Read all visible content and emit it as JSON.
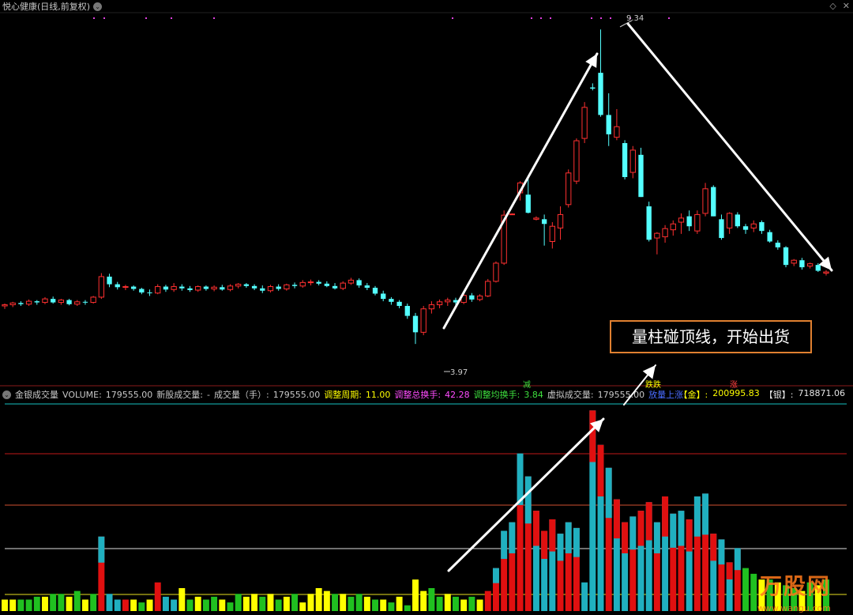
{
  "header": {
    "title": "悦心健康(日线,前复权)",
    "chev": "⌄",
    "icons": [
      "diamond-icon",
      "close-icon"
    ],
    "diamond_glyph": "◇",
    "close_glyph": "✕"
  },
  "price_labels": {
    "high": "9.34",
    "low": "3.97"
  },
  "callout": "量柱碰顶线，开始出货",
  "signals": {
    "jian": "减",
    "xi": "跌跌",
    "zhang": "涨"
  },
  "indicator": {
    "name": "金银成交量",
    "volume_label": "VOLUME:",
    "volume_value": "179555.00",
    "new_vol_label": "新股成交量:",
    "new_vol_value": "-",
    "vol_hand_label": "成交量（手）:",
    "vol_hand_value": "179555.00",
    "period_label": "调整周期:",
    "period_value": "11.00",
    "turnover_total_label": "调整总换手:",
    "turnover_total_value": "42.28",
    "turnover_avg_label": "调整均换手:",
    "turnover_avg_value": "3.84",
    "virtual_label": "虚拟成交量:",
    "virtual_value": "179555.00",
    "rise_label": "放量上涨:",
    "gold_label": "【金】:",
    "gold_value": "200995.83",
    "silver_label": "【银】:",
    "silver_value": "718871.06"
  },
  "watermark": {
    "brand": "万股网",
    "url": "www.wangu.com"
  },
  "colors": {
    "up": "#ff3030",
    "down": "#54ffff",
    "vol_up": "#e01010",
    "vol_down": "#20b0c0",
    "vol_low_up": "#ffff00",
    "vol_low_down": "#20c020"
  },
  "chart_data": {
    "type": "candlestick",
    "candles": [
      [
        4.62,
        4.66,
        4.57,
        4.64
      ],
      [
        4.64,
        4.69,
        4.6,
        4.67
      ],
      [
        4.67,
        4.7,
        4.62,
        4.65
      ],
      [
        4.65,
        4.73,
        4.62,
        4.7
      ],
      [
        4.7,
        4.72,
        4.64,
        4.68
      ],
      [
        4.68,
        4.77,
        4.65,
        4.74
      ],
      [
        4.74,
        4.78,
        4.66,
        4.68
      ],
      [
        4.68,
        4.74,
        4.64,
        4.72
      ],
      [
        4.72,
        4.74,
        4.63,
        4.65
      ],
      [
        4.65,
        4.72,
        4.62,
        4.69
      ],
      [
        4.69,
        4.72,
        4.64,
        4.68
      ],
      [
        4.68,
        4.79,
        4.66,
        4.77
      ],
      [
        4.77,
        5.18,
        4.74,
        5.12
      ],
      [
        5.12,
        5.17,
        4.94,
        4.99
      ],
      [
        4.99,
        5.03,
        4.9,
        4.94
      ],
      [
        4.94,
        4.98,
        4.89,
        4.95
      ],
      [
        4.95,
        4.97,
        4.88,
        4.91
      ],
      [
        4.91,
        4.93,
        4.82,
        4.85
      ],
      [
        4.85,
        4.9,
        4.79,
        4.84
      ],
      [
        4.84,
        4.99,
        4.82,
        4.95
      ],
      [
        4.95,
        4.98,
        4.86,
        4.9
      ],
      [
        4.9,
        5.01,
        4.86,
        4.95
      ],
      [
        4.95,
        4.99,
        4.88,
        4.92
      ],
      [
        4.92,
        4.96,
        4.86,
        4.89
      ],
      [
        4.89,
        4.97,
        4.86,
        4.95
      ],
      [
        4.95,
        4.97,
        4.88,
        4.91
      ],
      [
        4.91,
        4.97,
        4.87,
        4.94
      ],
      [
        4.94,
        4.98,
        4.88,
        4.9
      ],
      [
        4.9,
        4.99,
        4.87,
        4.96
      ],
      [
        4.96,
        5.01,
        4.92,
        4.99
      ],
      [
        4.99,
        5.01,
        4.93,
        4.96
      ],
      [
        4.96,
        4.99,
        4.89,
        4.92
      ],
      [
        4.92,
        4.97,
        4.84,
        4.88
      ],
      [
        4.88,
        4.98,
        4.85,
        4.95
      ],
      [
        4.95,
        4.99,
        4.88,
        4.91
      ],
      [
        4.91,
        5.0,
        4.88,
        4.98
      ],
      [
        4.98,
        5.02,
        4.92,
        4.96
      ],
      [
        4.96,
        5.06,
        4.93,
        5.02
      ],
      [
        5.02,
        5.07,
        4.97,
        5.03
      ],
      [
        5.03,
        5.06,
        4.97,
        5.0
      ],
      [
        5.0,
        5.04,
        4.94,
        4.96
      ],
      [
        4.96,
        5.01,
        4.9,
        4.92
      ],
      [
        4.92,
        5.04,
        4.89,
        5.01
      ],
      [
        5.01,
        5.1,
        4.98,
        5.06
      ],
      [
        5.06,
        5.09,
        4.93,
        4.97
      ],
      [
        4.97,
        5.01,
        4.89,
        4.93
      ],
      [
        4.93,
        4.96,
        4.8,
        4.83
      ],
      [
        4.83,
        4.88,
        4.7,
        4.74
      ],
      [
        4.74,
        4.77,
        4.64,
        4.69
      ],
      [
        4.69,
        4.72,
        4.58,
        4.62
      ],
      [
        4.62,
        4.66,
        4.4,
        4.45
      ],
      [
        4.45,
        4.5,
        3.97,
        4.17
      ],
      [
        4.17,
        4.62,
        4.12,
        4.57
      ],
      [
        4.57,
        4.7,
        4.49,
        4.64
      ],
      [
        4.64,
        4.73,
        4.58,
        4.69
      ],
      [
        4.69,
        4.76,
        4.62,
        4.72
      ],
      [
        4.72,
        4.76,
        4.64,
        4.68
      ],
      [
        4.68,
        4.84,
        4.65,
        4.8
      ],
      [
        4.8,
        4.84,
        4.69,
        4.73
      ],
      [
        4.73,
        4.82,
        4.7,
        4.79
      ],
      [
        4.79,
        5.08,
        4.77,
        5.04
      ],
      [
        5.04,
        5.38,
        5.02,
        5.35
      ],
      [
        5.35,
        6.25,
        5.32,
        6.17
      ],
      [
        6.18,
        6.2,
        6.18,
        6.19
      ],
      [
        6.55,
        6.75,
        6.42,
        6.72
      ],
      [
        6.52,
        6.85,
        6.2,
        6.21
      ],
      [
        6.1,
        6.15,
        6.08,
        6.12
      ],
      [
        6.1,
        6.18,
        5.65,
        6.02
      ],
      [
        5.72,
        6.05,
        5.6,
        5.98
      ],
      [
        5.95,
        6.32,
        5.75,
        6.18
      ],
      [
        6.35,
        6.95,
        6.3,
        6.89
      ],
      [
        6.75,
        7.48,
        6.7,
        7.44
      ],
      [
        7.48,
        8.1,
        7.4,
        8.01
      ],
      [
        8.35,
        8.42,
        8.3,
        8.33
      ],
      [
        8.6,
        9.34,
        7.85,
        7.88
      ],
      [
        7.88,
        8.25,
        7.35,
        7.55
      ],
      [
        7.5,
        7.98,
        7.45,
        7.68
      ],
      [
        7.4,
        7.45,
        6.78,
        6.82
      ],
      [
        6.9,
        7.35,
        6.8,
        7.28
      ],
      [
        7.2,
        7.32,
        6.48,
        6.48
      ],
      [
        6.32,
        6.4,
        5.72,
        5.75
      ],
      [
        5.78,
        5.88,
        5.5,
        5.86
      ],
      [
        5.8,
        6.0,
        5.7,
        5.94
      ],
      [
        5.92,
        6.08,
        5.82,
        6.02
      ],
      [
        6.05,
        6.2,
        5.85,
        6.12
      ],
      [
        6.15,
        6.25,
        5.9,
        5.98
      ],
      [
        5.9,
        6.25,
        5.85,
        6.18
      ],
      [
        6.2,
        6.72,
        6.15,
        6.62
      ],
      [
        6.65,
        6.68,
        6.15,
        6.15
      ],
      [
        6.1,
        6.18,
        5.75,
        5.78
      ],
      [
        5.95,
        6.22,
        5.85,
        6.2
      ],
      [
        6.18,
        6.22,
        5.95,
        5.98
      ],
      [
        5.98,
        6.02,
        5.85,
        5.92
      ],
      [
        5.95,
        6.08,
        5.88,
        6.02
      ],
      [
        6.05,
        6.08,
        5.85,
        5.9
      ],
      [
        5.88,
        5.92,
        5.7,
        5.72
      ],
      [
        5.7,
        5.74,
        5.58,
        5.62
      ],
      [
        5.62,
        5.64,
        5.28,
        5.32
      ],
      [
        5.35,
        5.42,
        5.3,
        5.4
      ],
      [
        5.4,
        5.44,
        5.24,
        5.28
      ],
      [
        5.3,
        5.36,
        5.26,
        5.34
      ],
      [
        5.32,
        5.35,
        5.2,
        5.22
      ],
      [
        5.18,
        5.23,
        5.14,
        5.2
      ]
    ],
    "volumes": [
      4,
      4,
      4,
      4,
      5,
      5,
      6,
      6,
      5,
      7,
      4,
      6,
      26,
      6,
      4,
      4,
      4,
      3,
      4,
      10,
      5,
      4,
      8,
      4,
      5,
      4,
      5,
      4,
      3,
      6,
      5,
      6,
      5,
      6,
      4,
      5,
      6,
      3,
      6,
      8,
      7,
      6,
      6,
      5,
      6,
      5,
      4,
      4,
      3,
      5,
      2,
      11,
      7,
      8,
      5,
      6,
      5,
      4,
      5,
      4,
      7,
      15,
      28,
      31,
      55,
      47,
      35,
      28,
      32,
      27,
      31,
      29,
      10,
      70,
      58,
      50,
      39,
      31,
      33,
      35,
      38,
      31,
      40,
      34,
      35,
      32,
      40,
      41,
      27,
      25,
      17,
      22,
      15,
      13,
      11,
      11,
      10,
      9,
      8,
      7,
      10,
      9,
      11
    ],
    "volume_color": [
      "y",
      "y",
      "g",
      "g",
      "g",
      "y",
      "g",
      "g",
      "y",
      "g",
      "y",
      "g",
      "u",
      "d",
      "d",
      "u",
      "y",
      "g",
      "y",
      "u",
      "d",
      "d",
      "y",
      "g",
      "y",
      "g",
      "g",
      "y",
      "g",
      "g",
      "y",
      "y",
      "g",
      "y",
      "g",
      "y",
      "g",
      "y",
      "y",
      "y",
      "y",
      "g",
      "y",
      "g",
      "g",
      "y",
      "g",
      "y",
      "g",
      "y",
      "g",
      "y",
      "y",
      "g",
      "g",
      "y",
      "g",
      "y",
      "g",
      "y",
      "u",
      "u",
      "u",
      "u",
      "u",
      "u",
      "d",
      "d",
      "d",
      "u",
      "u",
      "u",
      "d",
      "d",
      "d",
      "u",
      "d",
      "d",
      "u",
      "d",
      "d",
      "u",
      "d",
      "u",
      "u",
      "d",
      "u",
      "u",
      "d",
      "u",
      "d",
      "u",
      "g",
      "g",
      "y",
      "g",
      "y",
      "g",
      "g",
      "y",
      "g",
      "y",
      "g"
    ],
    "ylim": [
      3.5,
      9.6
    ],
    "high_marker": "9.34",
    "low_marker": "3.97",
    "volume_ref_lines": [
      156,
      110,
      77,
      49,
      12
    ]
  }
}
